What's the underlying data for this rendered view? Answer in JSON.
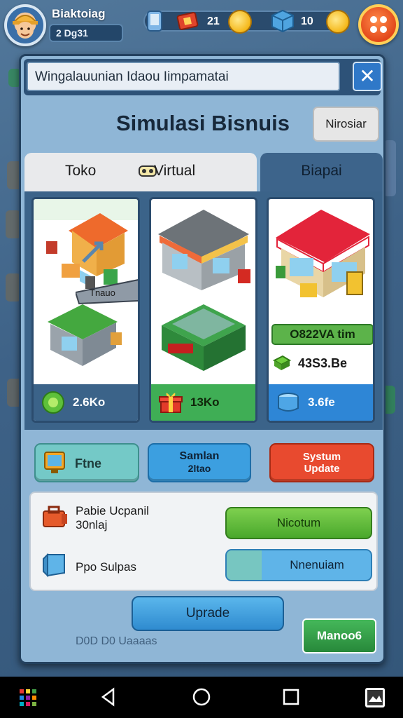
{
  "player": {
    "name": "Biaktoiag",
    "sub": "2 Dg31"
  },
  "resources": {
    "count_1": "21",
    "count_2": "10"
  },
  "panel": {
    "header_text": "Wingalauunian Idaou Iimpamatai",
    "close_label": "✕",
    "title": "Simulasi Bisnuis",
    "title_button": "Nirosiar"
  },
  "tabs": [
    {
      "label": "Toko"
    },
    {
      "label": "Virtual"
    },
    {
      "label": "Biapai"
    }
  ],
  "cards": [
    {
      "footer_value": "2.6Ko",
      "footer_color": "#3b6389",
      "footer_text_color": "#ffffff"
    },
    {
      "footer_value": "13Ko",
      "footer_color": "#3fae55",
      "footer_text_color": "#10240a"
    },
    {
      "footer_value": "3.6fe",
      "footer_color": "#2e86d6",
      "footer_text_color": "#ffffff",
      "price_tag": "O822VA tim",
      "money": "43S3.Be"
    }
  ],
  "card_sign": "Tnauo",
  "buttons": {
    "teal": "Ftne",
    "blue_line1": "Samlan",
    "blue_line2": "2ltao",
    "red_line1": "Systum",
    "red_line2": "Update"
  },
  "upgrade_box": {
    "label_1_line1": "Pabie Ucpanil",
    "label_1_line2": "30nlaj",
    "label_2": "Ppo Sulpas",
    "green_button": "Nicotum",
    "split_button": "Nnenuiam"
  },
  "upgrade_button": "Uprade",
  "next_button": "Manoo6",
  "faded_text": "D0D D0 Uaaaas",
  "colors": {
    "panel": "#8fb6d6",
    "header": "#2d5278",
    "accent_red": "#e84a2f",
    "accent_green": "#4aa82c"
  }
}
